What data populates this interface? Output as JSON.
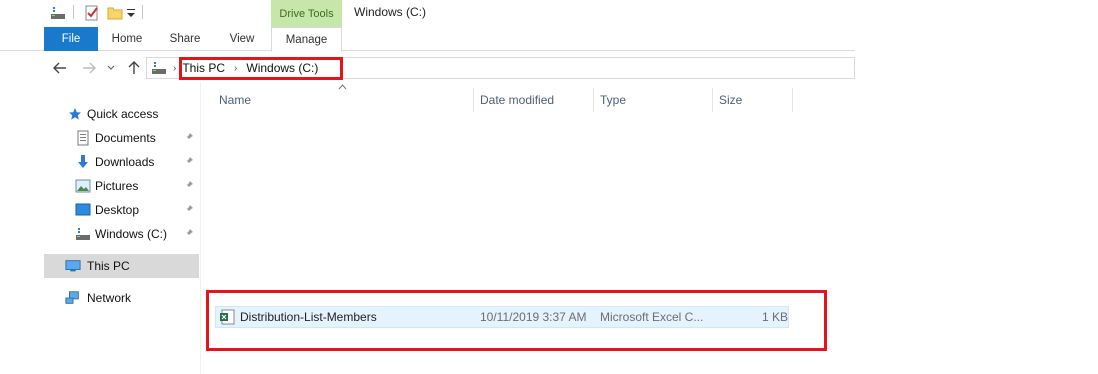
{
  "window": {
    "context_tab_group": "Drive Tools",
    "title": "Windows (C:)"
  },
  "ribbon": {
    "tabs": [
      "File",
      "Home",
      "Share",
      "View",
      "Manage"
    ]
  },
  "address_bar": {
    "crumbs": [
      "This PC",
      "Windows (C:)"
    ]
  },
  "nav_pane": {
    "quick_access": "Quick access",
    "pinned": [
      {
        "label": "Documents",
        "icon": "documents-icon"
      },
      {
        "label": "Downloads",
        "icon": "downloads-icon"
      },
      {
        "label": "Pictures",
        "icon": "pictures-icon"
      },
      {
        "label": "Desktop",
        "icon": "desktop-icon"
      },
      {
        "label": "Windows (C:)",
        "icon": "drive-icon"
      }
    ],
    "this_pc": "This PC",
    "network": "Network"
  },
  "columns": {
    "name": "Name",
    "date_modified": "Date modified",
    "type": "Type",
    "size": "Size"
  },
  "files": [
    {
      "name": "Distribution-List-Members",
      "date_modified": "10/11/2019 3:37 AM",
      "type": "Microsoft Excel C...",
      "size": "1 KB",
      "icon": "excel-csv-icon"
    }
  ],
  "colors": {
    "accent": "#1979ca",
    "context_tab": "#c7e6a9",
    "highlight_annotation": "#e3141c",
    "selection": "#e5f3ff"
  }
}
